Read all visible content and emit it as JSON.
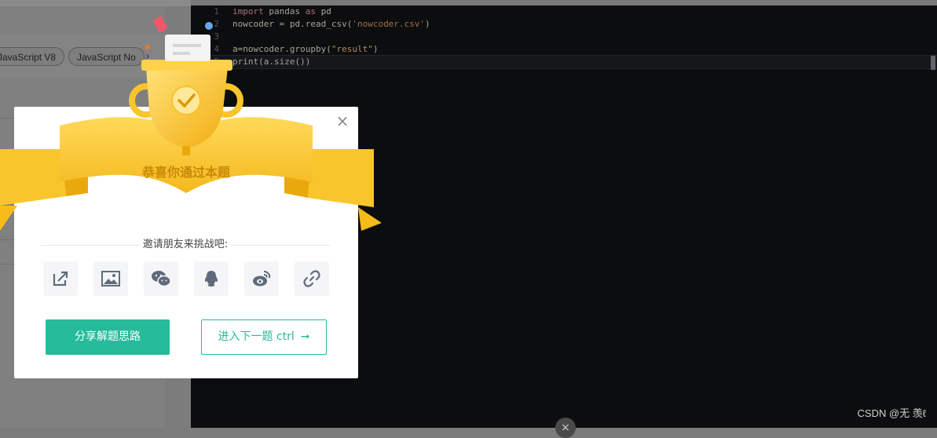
{
  "left_panel": {
    "language_tabs": [
      "JavaScript V8",
      "JavaScript No"
    ],
    "scroll_arrow": "›"
  },
  "editor": {
    "lines": [
      {
        "num": "1",
        "text": "import pandas as pd"
      },
      {
        "num": "2",
        "text": "nowcoder = pd.read_csv('nowcoder.csv')"
      },
      {
        "num": "3",
        "text": ""
      },
      {
        "num": "4",
        "text": "a=nowcoder.groupby(\"result\")"
      },
      {
        "num": "5",
        "text": "print(a.size())"
      }
    ],
    "watermark": "CSDN @无 羡ℓ"
  },
  "modal": {
    "title": "恭喜你通过本题",
    "invite_text": "邀请朋友来挑战吧:",
    "share_buttons": [
      {
        "name": "external-share-icon"
      },
      {
        "name": "image-share-icon"
      },
      {
        "name": "wechat-icon"
      },
      {
        "name": "qq-icon"
      },
      {
        "name": "weibo-icon"
      },
      {
        "name": "link-icon"
      }
    ],
    "primary_button": "分享解题思路",
    "next_button": "进入下一题 ctrl",
    "next_arrow": "➞"
  },
  "colors": {
    "accent": "#25bb9b",
    "gold": "#f7c22c",
    "editor_bg": "#0c0d0e"
  }
}
